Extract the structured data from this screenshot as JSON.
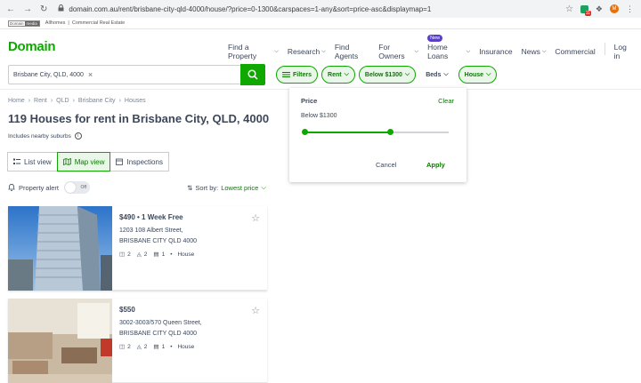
{
  "browser": {
    "url": "domain.com.au/rent/brisbane-city-qld-4000/house/?price=0-1300&carspaces=1-any&sort=price-asc&displaymap=1",
    "avatar_letter": "M",
    "ext_badge": "11"
  },
  "subbar": {
    "badge_left": "Domain",
    "badge_right": "media",
    "links": [
      "Allhomes",
      "|",
      "Commercial Real Estate"
    ]
  },
  "header": {
    "logo": "Domain",
    "nav": [
      {
        "label": "Find a Property",
        "chevron": true
      },
      {
        "label": "Research",
        "chevron": true
      },
      {
        "label": "Find Agents",
        "chevron": false
      },
      {
        "label": "For Owners",
        "chevron": true
      },
      {
        "label": "Home Loans",
        "chevron": true,
        "badge": "New"
      },
      {
        "label": "Insurance",
        "chevron": false
      },
      {
        "label": "News",
        "chevron": true
      },
      {
        "label": "Commercial",
        "chevron": false
      }
    ],
    "login": "Log in"
  },
  "search": {
    "chip": "Brisbane City, QLD, 4000",
    "chip_remove": "×"
  },
  "filters": {
    "filters_label": "Filters",
    "rent": "Rent",
    "price": "Below $1300",
    "beds": "Beds",
    "type": "House"
  },
  "breadcrumb": [
    "Home",
    "Rent",
    "QLD",
    "Brisbane City",
    "Houses"
  ],
  "breadcrumb_sep": "›",
  "page_title": "119 Houses for rent in Brisbane City, QLD, 4000",
  "nearby_text": "Includes nearby suburbs",
  "view_tabs": {
    "list": "List view",
    "map": "Map view",
    "inspections": "Inspections"
  },
  "alert": {
    "label": "Property alert",
    "toggle": "Off"
  },
  "sort": {
    "label": "Sort by:",
    "value": "Lowest price"
  },
  "listings": [
    {
      "price": "$490 • 1 Week Free",
      "street": "1203 108 Albert Street,",
      "suburb": "BRISBANE CITY QLD 4000",
      "beds": "2",
      "baths": "2",
      "cars": "1",
      "type": "House"
    },
    {
      "price": "$550",
      "street": "3002-3003/570 Queen Street,",
      "suburb": "BRISBANE CITY QLD 4000",
      "beds": "2",
      "baths": "2",
      "cars": "1",
      "type": "House"
    }
  ],
  "price_popover": {
    "title": "Price",
    "clear": "Clear",
    "value": "Below $1300",
    "slider_min_fraction": 0,
    "slider_max_fraction": 0.59,
    "cancel": "Cancel",
    "apply": "Apply"
  },
  "colors": {
    "brand": "#0ea800",
    "brand_dark": "#0b7a00",
    "new_badge": "#5940c4"
  }
}
